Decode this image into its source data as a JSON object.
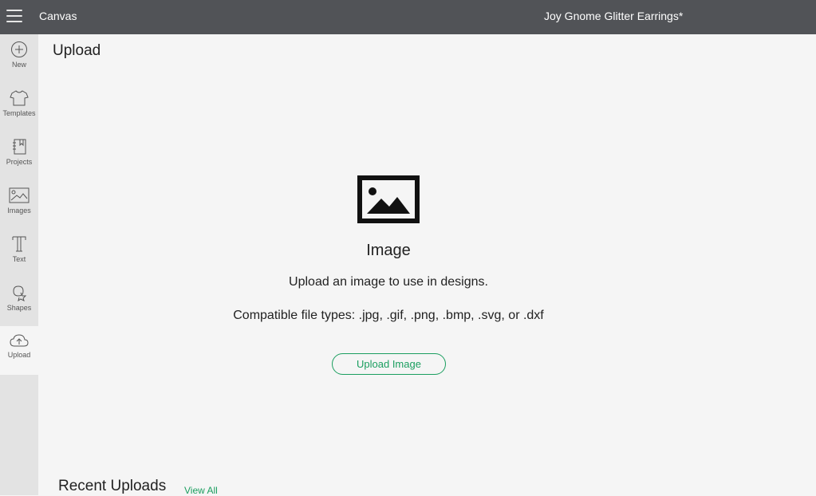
{
  "topbar": {
    "app_title": "Canvas",
    "project_name": "Joy Gnome Glitter Earrings*",
    "menu_icon": "hamburger-menu-icon",
    "background": "#515357"
  },
  "sidebar": {
    "items": [
      {
        "label": "New",
        "icon": "plus-circle-icon"
      },
      {
        "label": "Templates",
        "icon": "tshirt-icon"
      },
      {
        "label": "Projects",
        "icon": "notebook-icon"
      },
      {
        "label": "Images",
        "icon": "image-icon"
      },
      {
        "label": "Text",
        "icon": "text-t-icon"
      },
      {
        "label": "Shapes",
        "icon": "shapes-icon"
      },
      {
        "label": "Upload",
        "icon": "cloud-upload-icon",
        "active": true
      }
    ]
  },
  "main": {
    "page_title": "Upload",
    "hero": {
      "icon": "image-placeholder-icon",
      "heading": "Image",
      "description": "Upload an image to use in designs.",
      "file_types": "Compatible file types: .jpg, .gif, .png, .bmp, .svg, or .dxf",
      "button_label": "Upload Image"
    },
    "recent": {
      "title": "Recent Uploads",
      "view_all": "View All"
    }
  },
  "colors": {
    "accent": "#1a9e5f",
    "sidebar_bg": "#e3e3e3",
    "main_bg": "#f5f5f5"
  }
}
